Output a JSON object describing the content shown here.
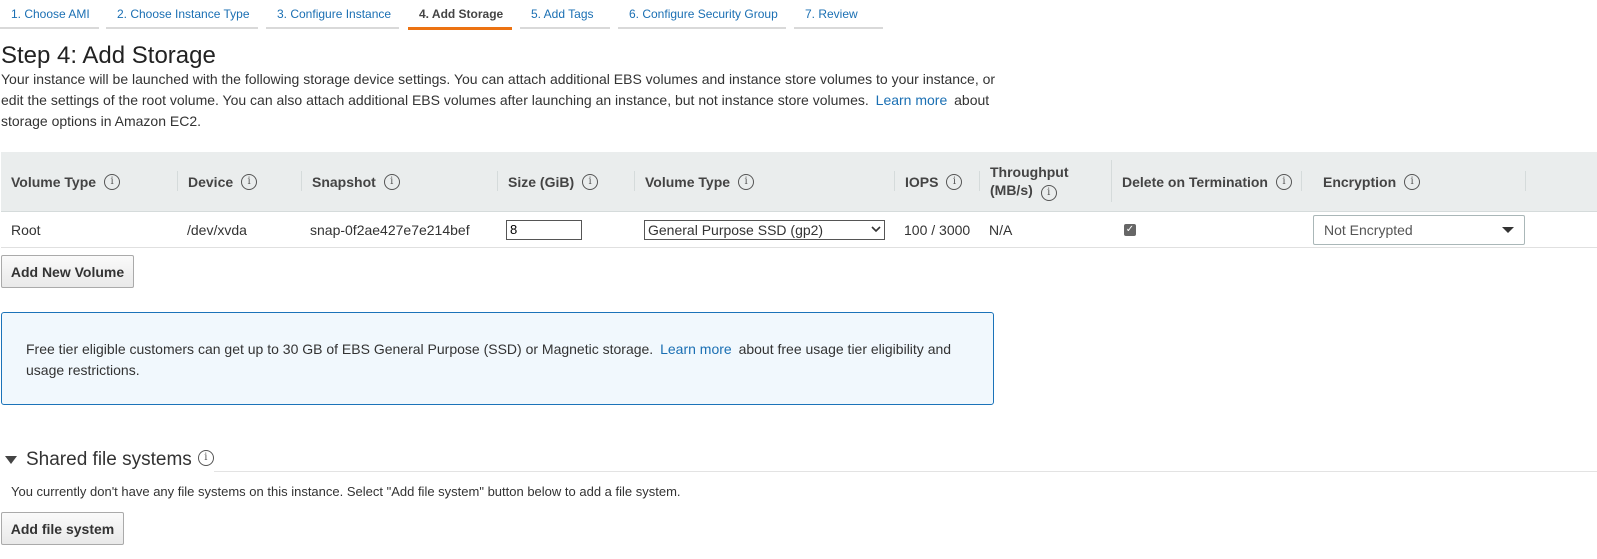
{
  "wizard_tabs": [
    {
      "label": "1. Choose AMI"
    },
    {
      "label": "2. Choose Instance Type"
    },
    {
      "label": "3. Configure Instance"
    },
    {
      "label": "4. Add Storage"
    },
    {
      "label": "5. Add Tags"
    },
    {
      "label": "6. Configure Security Group"
    },
    {
      "label": "7. Review"
    }
  ],
  "page": {
    "title": "Step 4: Add Storage",
    "desc_part1": "Your instance will be launched with the following storage device settings. You can attach additional EBS volumes and instance store volumes to your instance, or edit the settings of the root volume. You can also attach additional EBS volumes after launching an instance, but not instance store volumes.",
    "desc_link": "Learn more",
    "desc_part2": "about storage options in Amazon EC2."
  },
  "table": {
    "headers": {
      "volume_type": "Volume Type",
      "device": "Device",
      "snapshot": "Snapshot",
      "size": "Size (GiB)",
      "ebs_type": "Volume Type",
      "iops": "IOPS",
      "throughput_line1": "Throughput",
      "throughput_line2": "(MB/s)",
      "delete_on_termination": "Delete on Termination",
      "encryption": "Encryption"
    },
    "row": {
      "volume_type": "Root",
      "device": "/dev/xvda",
      "snapshot": "snap-0f2ae427e7e214bef",
      "size": "8",
      "ebs_type": "General Purpose SSD (gp2)",
      "iops": "100 / 3000",
      "throughput": "N/A",
      "delete_on_termination": true,
      "encryption": "Not Encrypted"
    }
  },
  "buttons": {
    "add_volume": "Add New Volume",
    "add_file_system": "Add file system"
  },
  "info_box": {
    "part1": "Free tier eligible customers can get up to 30 GB of EBS General Purpose (SSD) or Magnetic storage.",
    "link": "Learn more",
    "part2": "about free usage tier eligibility and usage restrictions."
  },
  "shared_fs": {
    "title": "Shared file systems",
    "message": "You currently don't have any file systems on this instance. Select \"Add file system\" button below to add a file system."
  },
  "icons": {
    "info": "i",
    "check": "✓"
  },
  "colors": {
    "link": "#1a6fb3",
    "active_tab": "#ec7211",
    "info_border": "#1b73b9",
    "header_bg": "#eaeded"
  }
}
